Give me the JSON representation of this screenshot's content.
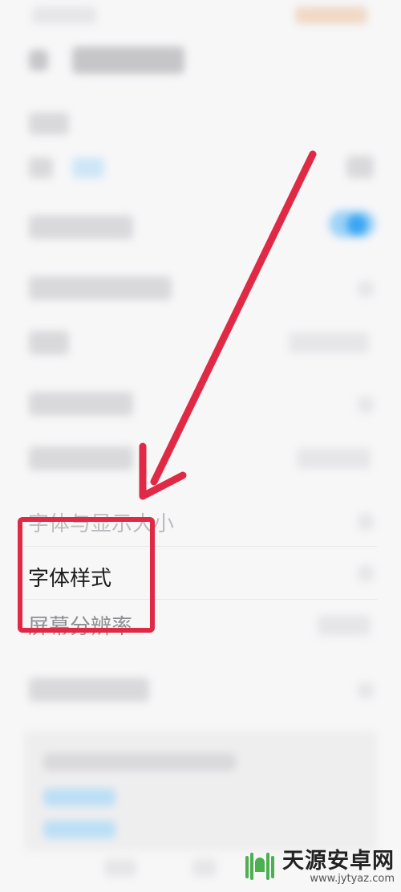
{
  "rows": {
    "font_and_display_size": "字体与显示大小",
    "font_style": "字体样式",
    "screen_resolution": "屏幕分辨率"
  },
  "watermark": {
    "title": "天源安卓网",
    "url": "www.jytyaz.com"
  },
  "colors": {
    "annotation_red": "#e02a45",
    "toggle_blue": "#3aa6f2",
    "watermark_green": "#4caf50"
  }
}
